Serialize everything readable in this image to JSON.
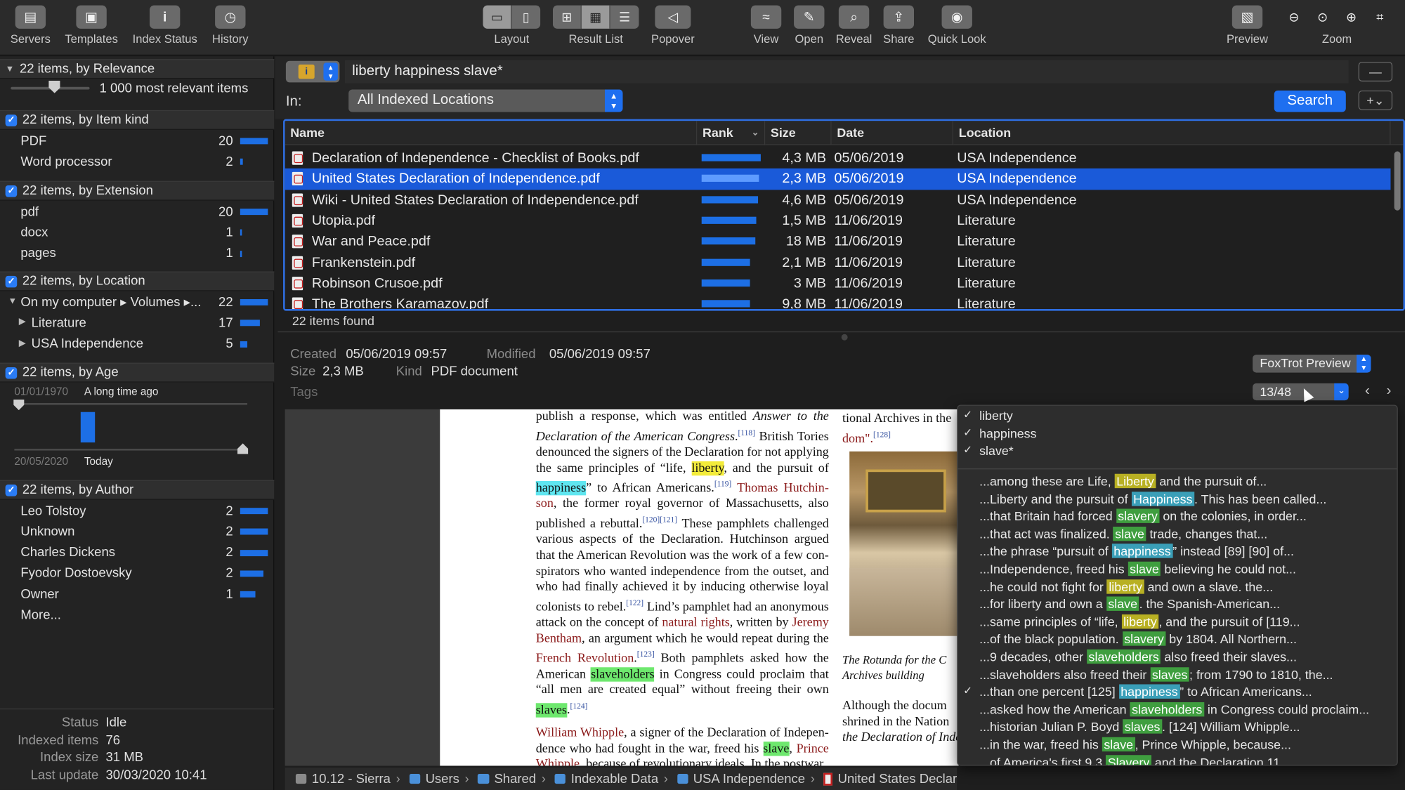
{
  "toolbar": {
    "left": [
      {
        "label": "Servers",
        "icon": "servers-icon"
      },
      {
        "label": "Templates",
        "icon": "templates-icon"
      },
      {
        "label": "Index Status",
        "icon": "info-icon"
      },
      {
        "label": "History",
        "icon": "clock-icon"
      }
    ],
    "layout_label": "Layout",
    "result_list_label": "Result List",
    "popover_label": "Popover",
    "right": [
      {
        "label": "View",
        "icon": "view-icon"
      },
      {
        "label": "Open",
        "icon": "pencil-icon"
      },
      {
        "label": "Reveal",
        "icon": "reveal-icon"
      },
      {
        "label": "Share",
        "icon": "share-icon"
      },
      {
        "label": "Quick Look",
        "icon": "eye-icon"
      }
    ],
    "preview_label": "Preview",
    "zoom_label": "Zoom"
  },
  "sidebar": {
    "relevance": {
      "header": "22 items, by Relevance",
      "slider_label": "1 000 most relevant items",
      "slider_value": 0.55
    },
    "kind": {
      "header": "22 items, by Item kind",
      "items": [
        {
          "label": "PDF",
          "count": "20",
          "share": 1.0
        },
        {
          "label": "Word processor",
          "count": "2",
          "share": 0.1
        }
      ]
    },
    "extension": {
      "header": "22 items, by Extension",
      "items": [
        {
          "label": "pdf",
          "count": "20",
          "share": 1.0
        },
        {
          "label": "docx",
          "count": "1",
          "share": 0.05
        },
        {
          "label": "pages",
          "count": "1",
          "share": 0.05
        }
      ]
    },
    "location": {
      "header": "22 items, by Location",
      "items": [
        {
          "label": "On my computer ▸ Volumes ▸...",
          "count": "22",
          "share": 1.0
        },
        {
          "label": "Literature",
          "count": "17",
          "share": 0.72
        },
        {
          "label": "USA Independence",
          "count": "5",
          "share": 0.25
        }
      ]
    },
    "age": {
      "header": "22 items, by Age",
      "from_date": "01/01/1970",
      "from_label": "A long time ago",
      "to_date": "20/05/2020",
      "to_label": "Today"
    },
    "author": {
      "header": "22 items, by Author",
      "items": [
        {
          "label": "Leo Tolstoy",
          "count": "2",
          "share": 1.0
        },
        {
          "label": "Unknown",
          "count": "2",
          "share": 1.0
        },
        {
          "label": "Charles Dickens",
          "count": "2",
          "share": 1.0
        },
        {
          "label": "Fyodor Dostoevsky",
          "count": "2",
          "share": 0.85
        },
        {
          "label": "Owner",
          "count": "1",
          "share": 0.55
        }
      ],
      "more": "More..."
    },
    "status": [
      {
        "k": "Status",
        "v": "Idle"
      },
      {
        "k": "Indexed items",
        "v": "76"
      },
      {
        "k": "Index size",
        "v": "31 MB"
      },
      {
        "k": "Last update",
        "v": "30/03/2020 10:41"
      }
    ]
  },
  "search": {
    "query": "liberty happiness slave*",
    "in_label": "In:",
    "location": "All Indexed Locations",
    "button": "Search",
    "minus": "—",
    "plus": "+⌄"
  },
  "table": {
    "columns": {
      "name": "Name",
      "rank": "Rank",
      "size": "Size",
      "date": "Date",
      "location": "Location"
    },
    "rows": [
      {
        "name": "Declaration of Independence  - Checklist of Books.pdf",
        "rank": 1.0,
        "size": "4,3 MB",
        "date": "05/06/2019",
        "location": "USA Independence"
      },
      {
        "name": "United States Declaration of Independence.pdf",
        "rank": 0.97,
        "size": "2,3 MB",
        "date": "05/06/2019",
        "location": "USA Independence",
        "selected": true
      },
      {
        "name": "Wiki - United States Declaration of Independence.pdf",
        "rank": 0.95,
        "size": "4,6 MB",
        "date": "05/06/2019",
        "location": "USA Independence"
      },
      {
        "name": "Utopia.pdf",
        "rank": 0.93,
        "size": "1,5 MB",
        "date": "11/06/2019",
        "location": "Literature"
      },
      {
        "name": "War and Peace.pdf",
        "rank": 0.91,
        "size": "18 MB",
        "date": "11/06/2019",
        "location": "Literature"
      },
      {
        "name": "Frankenstein.pdf",
        "rank": 0.82,
        "size": "2,1 MB",
        "date": "11/06/2019",
        "location": "Literature"
      },
      {
        "name": "Robinson Crusoe.pdf",
        "rank": 0.82,
        "size": "3 MB",
        "date": "11/06/2019",
        "location": "Literature"
      },
      {
        "name": "The Brothers Karamazov.pdf",
        "rank": 0.82,
        "size": "9,8 MB",
        "date": "11/06/2019",
        "location": "Literature"
      }
    ],
    "found": "22 items found"
  },
  "info": {
    "created_label": "Created",
    "created": "05/06/2019 09:57",
    "modified_label": "Modified",
    "modified": "05/06/2019 09:57",
    "size_label": "Size",
    "size": "2,3 MB",
    "kind_label": "Kind",
    "kind": "PDF document",
    "tags_label": "Tags",
    "preview_mode": "FoxTrot Preview",
    "hit_counter": "13/48"
  },
  "document": {
    "caption_line1": "The Rotunda for the C",
    "caption_line2": "Archives building",
    "right_top1": "tional Archives in the",
    "right_top2": "dom\".",
    "right_bottom1": "Although the docum",
    "right_bottom2": "shrined in the Nation",
    "right_bottom3": "the Declaration of Inde"
  },
  "dropdown": {
    "terms": [
      "liberty",
      "happiness",
      "slave*"
    ],
    "hits": [
      {
        "pre": "...among these are Life, ",
        "hit": "Liberty",
        "c": "y",
        "post": " and the pursuit of..."
      },
      {
        "pre": "...Liberty and the pursuit of ",
        "hit": "Happiness",
        "c": "c",
        "post": ". This has been called..."
      },
      {
        "pre": "...that Britain had forced ",
        "hit": "slavery",
        "c": "g",
        "post": " on the colonies, in order..."
      },
      {
        "pre": "...that act was finalized. ",
        "hit": "slave",
        "c": "g",
        "post": " trade, changes that..."
      },
      {
        "pre": "...the phrase “pursuit of ",
        "hit": "happiness",
        "c": "c",
        "post": "” instead [89] [90] of..."
      },
      {
        "pre": "...Independence, freed his ",
        "hit": "slave",
        "c": "g",
        "post": " believing he could not..."
      },
      {
        "pre": "...he could not fight for ",
        "hit": "liberty",
        "c": "y",
        "post": " and own a slave. the..."
      },
      {
        "pre": "...for liberty and own a ",
        "hit": "slave",
        "c": "g",
        "post": ". the Spanish-American..."
      },
      {
        "pre": "...same principles of “life, ",
        "hit": "liberty",
        "c": "y",
        "post": ", and the pursuit of [119..."
      },
      {
        "pre": "...of the black population. ",
        "hit": "slavery",
        "c": "g",
        "post": " by 1804. All Northern..."
      },
      {
        "pre": "...9 decades, other ",
        "hit": "slaveholders",
        "c": "g",
        "post": " also freed their slaves..."
      },
      {
        "pre": "...slaveholders also freed their ",
        "hit": "slaves",
        "c": "g",
        "post": "; from 1790 to 1810, the..."
      },
      {
        "pre": "...than one percent [125] ",
        "hit": "happiness",
        "c": "c",
        "post": "” to African Americans...",
        "checked": true
      },
      {
        "pre": "...asked how the American ",
        "hit": "slaveholders",
        "c": "g",
        "post": " in Congress could proclaim..."
      },
      {
        "pre": "...historian Julian P. Boyd ",
        "hit": "slaves",
        "c": "g",
        "post": ". [124] William Whipple..."
      },
      {
        "pre": "...in the war, freed his ",
        "hit": "slave",
        "c": "g",
        "post": ", Prince Whipple, because..."
      },
      {
        "pre": "...of America's first 9.3 ",
        "hit": "Slavery",
        "c": "g",
        "post": " and the Declaration 11..."
      }
    ]
  },
  "pathbar": {
    "items": [
      "10.12 - Sierra",
      "Users",
      "Shared",
      "Indexable Data",
      "USA Independence",
      "United States Declar"
    ]
  }
}
